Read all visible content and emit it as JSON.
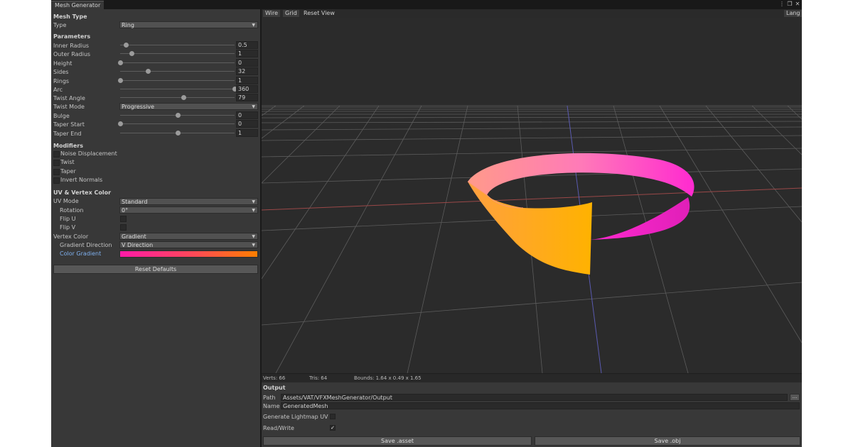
{
  "window": {
    "tab_title": "Mesh Generator",
    "icons": [
      "more-icon",
      "maximize-icon",
      "close-icon"
    ]
  },
  "mesh_type": {
    "section": "Mesh Type",
    "type_label": "Type",
    "type_value": "Ring"
  },
  "parameters": {
    "section": "Parameters",
    "sliders": [
      {
        "label": "Inner Radius",
        "value": "0.5",
        "fraction": 0.05
      },
      {
        "label": "Outer Radius",
        "value": "1",
        "fraction": 0.1
      },
      {
        "label": "Height",
        "value": "0",
        "fraction": 0.0
      },
      {
        "label": "Sides",
        "value": "32",
        "fraction": 0.24
      },
      {
        "label": "Rings",
        "value": "1",
        "fraction": 0.0
      },
      {
        "label": "Arc",
        "value": "360",
        "fraction": 1.0
      },
      {
        "label": "Twist Angle",
        "value": "79",
        "fraction": 0.55
      }
    ],
    "twist_mode_label": "Twist Mode",
    "twist_mode_value": "Progressive",
    "sliders2": [
      {
        "label": "Bulge",
        "value": "0",
        "fraction": 0.5
      },
      {
        "label": "Taper Start",
        "value": "0",
        "fraction": 0.0
      },
      {
        "label": "Taper End",
        "value": "1",
        "fraction": 0.5
      }
    ]
  },
  "modifiers": {
    "section": "Modifiers",
    "items": [
      {
        "label": "Noise Displacement",
        "checked": false
      },
      {
        "label": "Twist",
        "checked": false
      },
      {
        "label": "Taper",
        "checked": false
      },
      {
        "label": "Invert Normals",
        "checked": false
      }
    ]
  },
  "uv": {
    "section": "UV & Vertex Color",
    "uv_mode_label": "UV Mode",
    "uv_mode_value": "Standard",
    "rotation_label": "Rotation",
    "rotation_value": "0°",
    "flip_u_label": "Flip U",
    "flip_v_label": "Flip V",
    "vertex_color_label": "Vertex Color",
    "vertex_color_value": "Gradient",
    "gradient_dir_label": "Gradient Direction",
    "gradient_dir_value": "V Direction",
    "color_gradient_label": "Color Gradient",
    "gradient_colors": [
      "#ff1aa8",
      "#ff4a55",
      "#ff7f00"
    ]
  },
  "reset_defaults_label": "Reset Defaults",
  "viewport": {
    "buttons": [
      "Wire",
      "Grid",
      "Reset View"
    ],
    "lang_label": "Lang",
    "mesh_colors": [
      "#ffb000",
      "#ff8a9a",
      "#ff2ad0"
    ]
  },
  "stats": {
    "verts": "Verts: 66",
    "tris": "Tris: 64",
    "bounds": "Bounds: 1.64 x 0.49 x 1.65"
  },
  "output": {
    "section": "Output",
    "path_label": "Path",
    "path_value": "Assets/VAT/VFXMeshGenerator/Output",
    "browse_label": "...",
    "name_label": "Name",
    "name_value": "GeneratedMesh",
    "lightmap_label": "Generate Lightmap UV",
    "lightmap_checked": false,
    "readwrite_label": "Read/Write",
    "readwrite_checked": true,
    "save_asset_label": "Save .asset",
    "save_obj_label": "Save .obj"
  }
}
